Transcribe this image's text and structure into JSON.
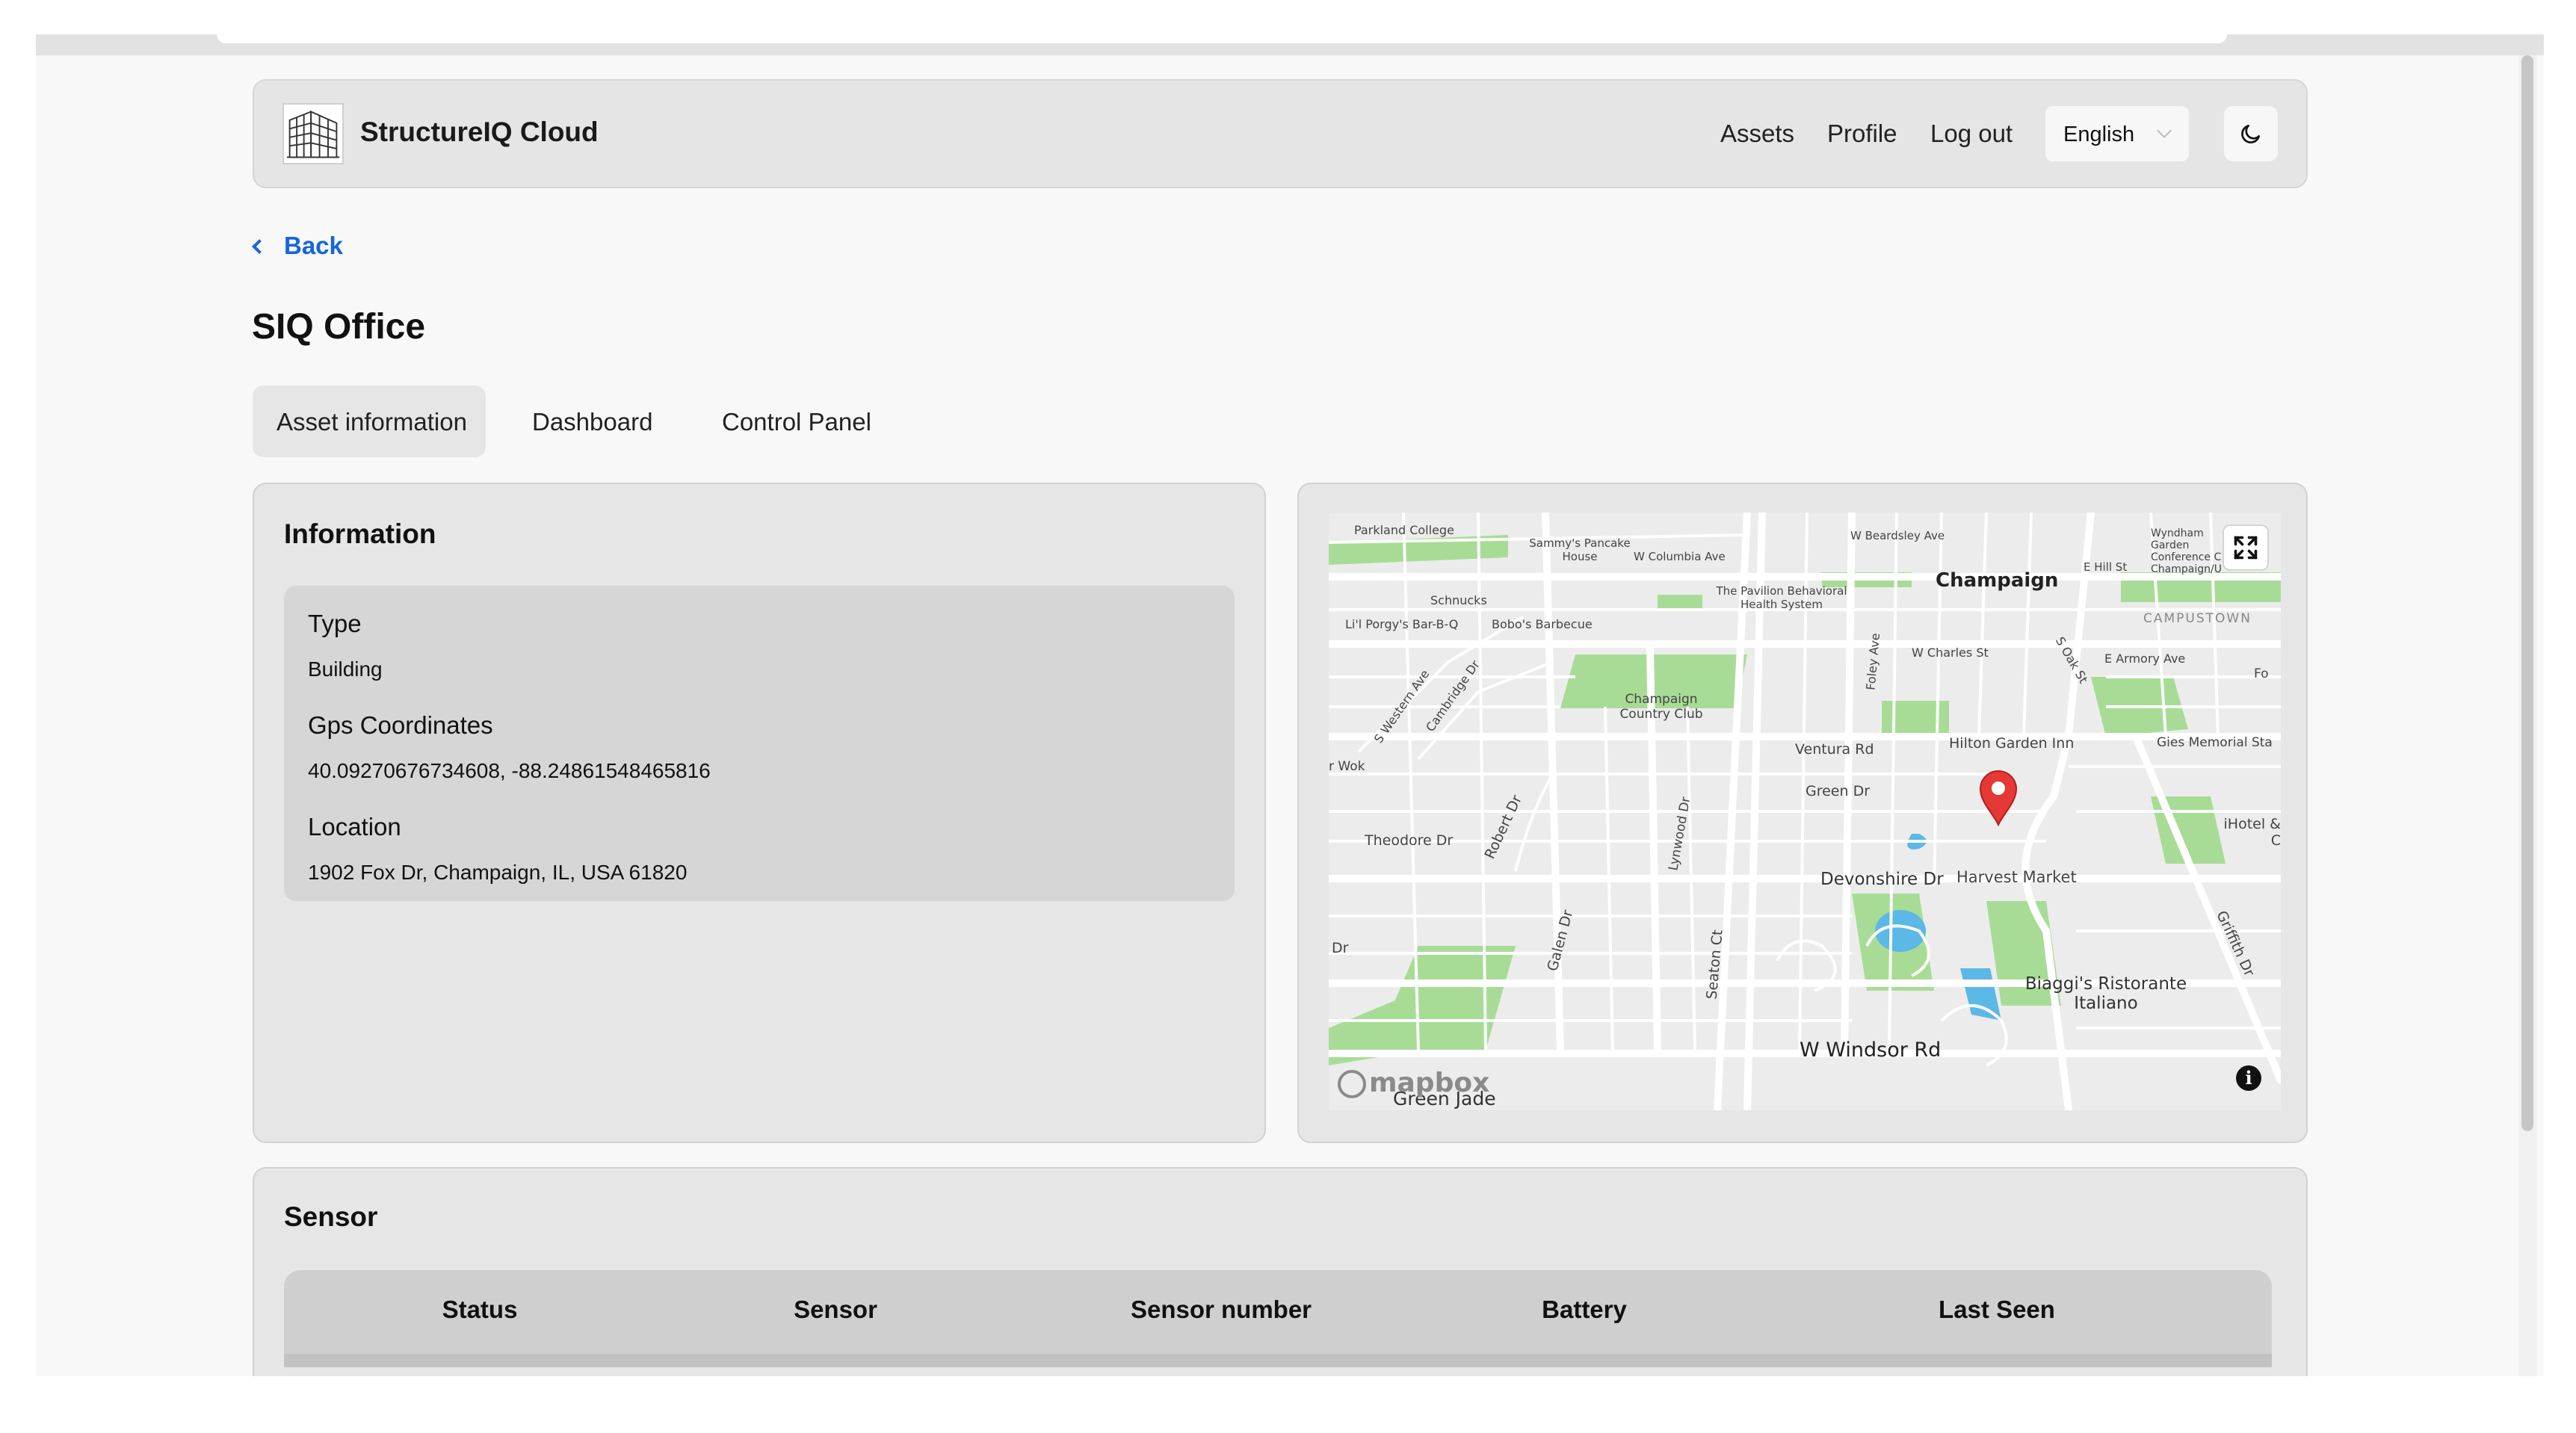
{
  "header": {
    "brand": "StructureIQ Cloud",
    "nav": [
      {
        "label": "Assets"
      },
      {
        "label": "Profile"
      },
      {
        "label": "Log out"
      }
    ],
    "language": "English",
    "theme_icon": "moon-icon"
  },
  "back_label": "Back",
  "page_title": "SIQ Office",
  "tabs": [
    {
      "label": "Asset information",
      "active": true
    },
    {
      "label": "Dashboard",
      "active": false
    },
    {
      "label": "Control Panel",
      "active": false
    }
  ],
  "information": {
    "title": "Information",
    "fields": [
      {
        "label": "Type",
        "value": "Building"
      },
      {
        "label": "Gps Coordinates",
        "value": "40.09270676734608, -88.24861548465816"
      },
      {
        "label": "Location",
        "value": "1902 Fox Dr, Champaign, IL, USA 61820"
      }
    ]
  },
  "map": {
    "attribution": "mapbox",
    "labels": {
      "champaign": "Champaign",
      "campustown": "CAMPUSTOWN",
      "parkland": "Parkland College",
      "sammys": "Sammy's Pancake House",
      "w_columbia": "W Columbia Ave",
      "w_beardsley": "W Beardsley Ave",
      "wyndham": "Wyndham Garden Conference C Champaign/U",
      "e_hill": "E Hill St",
      "schnucks": "Schnucks",
      "pavilion": "The Pavilion Behavioral Health System",
      "lil_porgy": "Li'l Porgy's Bar-B-Q",
      "bobos": "Bobo's Barbecue",
      "w_charles": "W Charles St",
      "e_armory": "E Armory Ave",
      "s_oak": "S Oak St",
      "s_western": "S Western Ave",
      "cambridge": "Cambridge Dr",
      "champaign_cc": "Champaign Country Club",
      "foley": "Foley Ave",
      "wok": "r Wok",
      "ventura": "Ventura Rd",
      "hilton": "Hilton Garden Inn",
      "gies": "Gies Memorial Sta",
      "green_dr": "Green Dr",
      "theodore": "Theodore Dr",
      "robert": "Robert Dr",
      "lynwood": "Lynwood Dr",
      "ihotel": "iHotel & C",
      "devonshire": "Devonshire Dr",
      "harvest": "Harvest Market",
      "galen": "Galen Dr",
      "seaton": "Seaton Ct",
      "griffith": "Griffith Dr",
      "dr_left": "Dr",
      "biaggis": "Biaggi's Ristorante Italiano",
      "w_windsor": "W Windsor Rd",
      "green_jade": "Green Jade",
      "fo": "Fo"
    }
  },
  "sensor": {
    "title": "Sensor",
    "columns": [
      "Status",
      "Sensor",
      "Sensor number",
      "Battery",
      "Last Seen"
    ]
  }
}
